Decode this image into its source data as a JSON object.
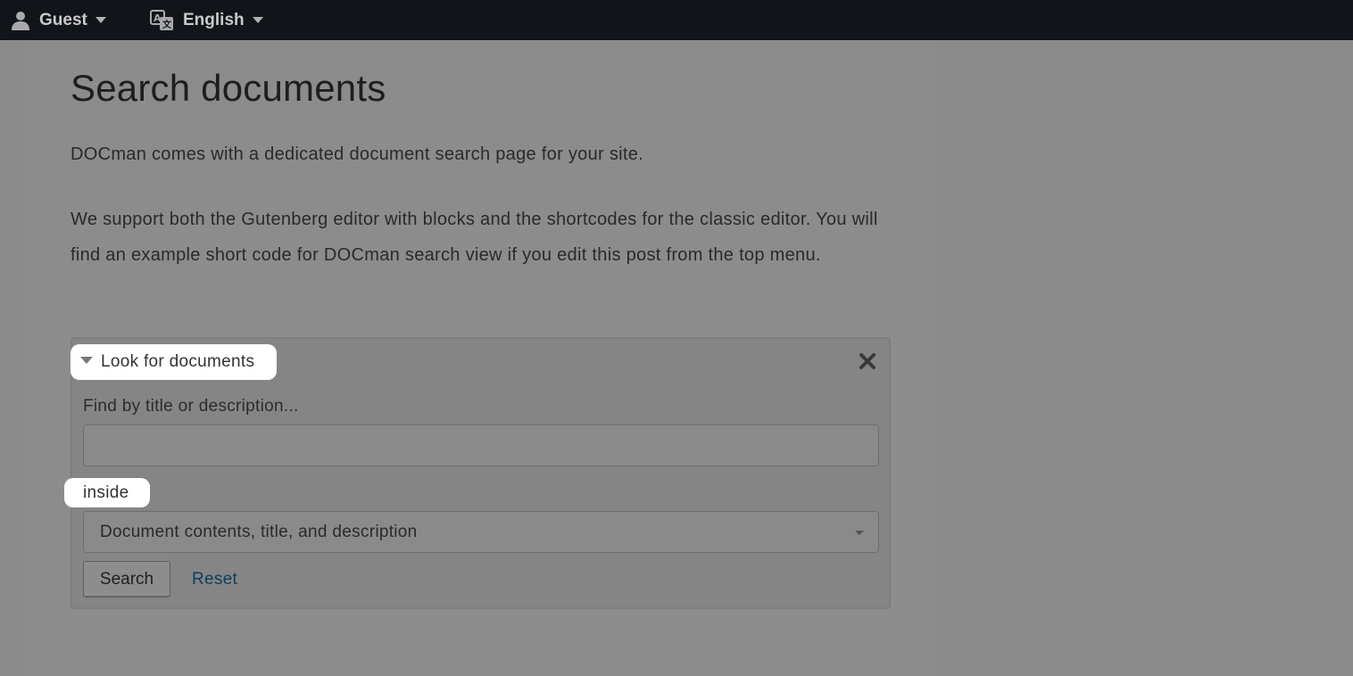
{
  "topbar": {
    "user_menu": {
      "label": "Guest",
      "icon": "user-icon"
    },
    "language_menu": {
      "label": "English",
      "icon": "translate-icon"
    }
  },
  "page": {
    "title": "Search documents",
    "paragraph1": "DOCman comes with a dedicated document search page for your site.",
    "paragraph2": "We support both the Gutenberg editor with blocks and the shortcodes for the classic editor. You will find an example short code for DOCman search view if you edit this post from the top menu."
  },
  "search_panel": {
    "legend": "Look for documents",
    "find_label": "Find by title or description...",
    "find_value": "",
    "inside_label": "inside",
    "inside_selected": "Document contents, title, and description",
    "search_button": "Search",
    "reset_link": "Reset"
  },
  "colors": {
    "topbar": "#11151a",
    "overlay": "#8a8a8a",
    "link": "#0b3f60"
  }
}
